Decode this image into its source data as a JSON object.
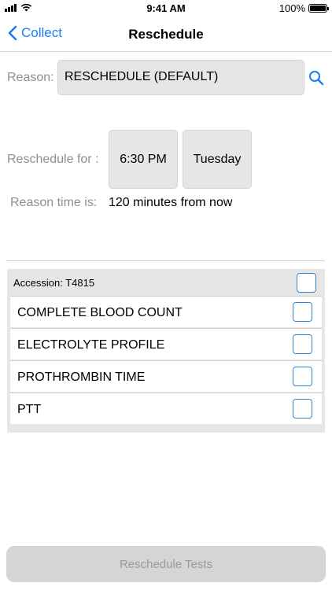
{
  "status_bar": {
    "time": "9:41 AM",
    "battery": "100%",
    "icons": [
      "signal-icon",
      "wifi-icon",
      "battery-icon"
    ]
  },
  "nav": {
    "back_label": "Collect",
    "title": "Reschedule"
  },
  "reason": {
    "label": "Reason:",
    "value": "RESCHEDULE (DEFAULT)"
  },
  "reschedule": {
    "label": "Reschedule for :",
    "time": "6:30 PM",
    "day": "Tuesday"
  },
  "reason_time": {
    "label": "Reason time is:",
    "value": "120 minutes from now"
  },
  "accession": {
    "label": "Accession: T4815",
    "checked": false
  },
  "tests": [
    {
      "name": "COMPLETE BLOOD COUNT",
      "checked": false
    },
    {
      "name": "ELECTROLYTE PROFILE",
      "checked": false
    },
    {
      "name": "PROTHROMBIN TIME",
      "checked": false
    },
    {
      "name": "PTT",
      "checked": false
    }
  ],
  "bottom_button": {
    "label": "Reschedule Tests",
    "enabled": false
  },
  "colors": {
    "accent": "#1a7ef5",
    "field_bg": "#e6e6e6",
    "label_gray": "#8e8e93",
    "checkbox_border": "#2f86d4"
  }
}
